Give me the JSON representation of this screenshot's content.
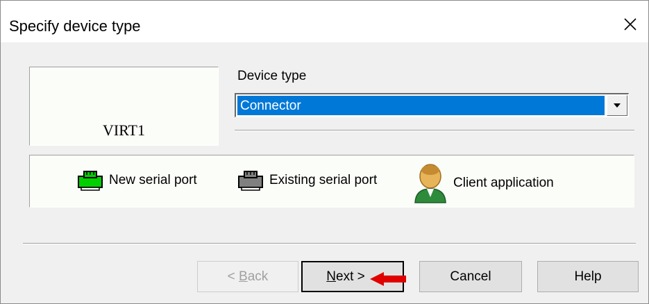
{
  "dialog": {
    "title": "Specify device type",
    "close_icon": "close-icon"
  },
  "preview": {
    "device_name": "VIRT1"
  },
  "device_type": {
    "label": "Device type",
    "selected": "Connector",
    "dropdown_icon": "chevron-down-icon"
  },
  "legend": {
    "items": [
      {
        "label": "New serial port",
        "icon": "serial-port-new-icon",
        "color": "#00d000"
      },
      {
        "label": "Existing serial port",
        "icon": "serial-port-existing-icon",
        "color": "#808080"
      },
      {
        "label": "Client application",
        "icon": "client-application-icon",
        "color": "#d9a441"
      }
    ]
  },
  "buttons": {
    "back": {
      "prefix": "< ",
      "accel": "B",
      "rest": "ack",
      "enabled": false
    },
    "next": {
      "accel": "N",
      "rest": "ext >",
      "default": true
    },
    "cancel": {
      "label": "Cancel"
    },
    "help": {
      "label": "Help"
    }
  },
  "annotation": {
    "icon": "red-arrow-icon",
    "color": "#e00000"
  }
}
